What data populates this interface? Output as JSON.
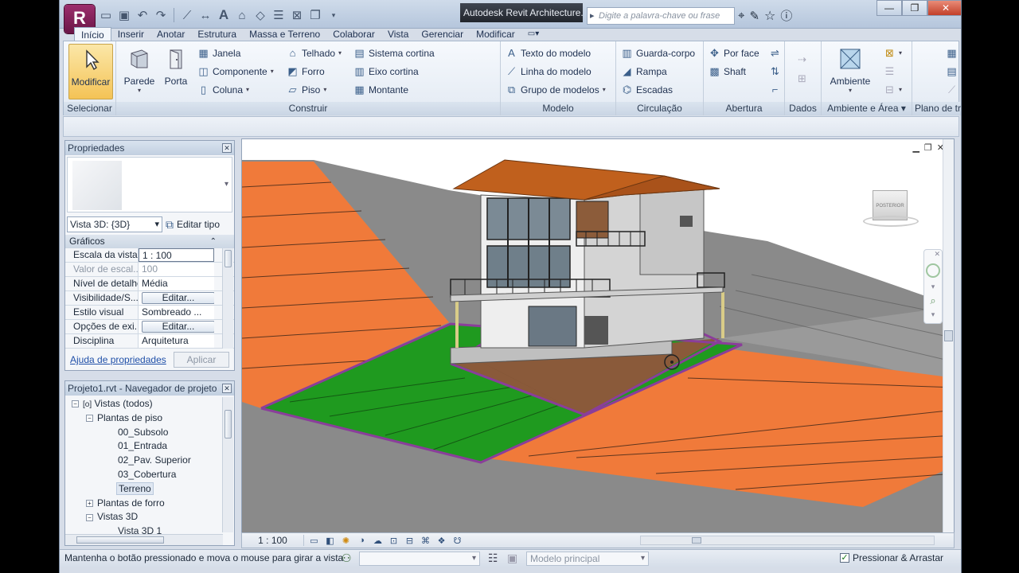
{
  "titlebar": {
    "app_title": "Autodesk Revit Architecture...",
    "search_placeholder": "Digite a palavra-chave ou frase",
    "app_button": "R"
  },
  "tabs": [
    "Início",
    "Inserir",
    "Anotar",
    "Estrutura",
    "Massa e Terreno",
    "Colaborar",
    "Vista",
    "Gerenciar",
    "Modificar"
  ],
  "ribbon": {
    "selecionar": {
      "label": "Selecionar",
      "modificar": "Modificar"
    },
    "construir": {
      "label": "Construir",
      "parede": "Parede",
      "porta": "Porta",
      "janela": "Janela",
      "componente": "Componente",
      "coluna": "Coluna",
      "telhado": "Telhado",
      "forro": "Forro",
      "piso": "Piso",
      "sistema_cortina": "Sistema cortina",
      "eixo_cortina": "Eixo cortina",
      "montante": "Montante"
    },
    "modelo": {
      "label": "Modelo",
      "texto": "Texto do modelo",
      "linha": "Linha do modelo",
      "grupo": "Grupo de modelos"
    },
    "circulacao": {
      "label": "Circulação",
      "guarda_corpo": "Guarda-corpo",
      "rampa": "Rampa",
      "escadas": "Escadas"
    },
    "abertura": {
      "label": "Abertura",
      "por_face": "Por face",
      "shaft": "Shaft"
    },
    "dados": {
      "label": "Dados"
    },
    "ambiente": {
      "label": "Ambiente e Área",
      "ambiente": "Ambiente"
    },
    "plano": {
      "label": "Plano de trabalho"
    }
  },
  "properties": {
    "title": "Propriedades",
    "view_type": "Vista 3D: {3D}",
    "edit_type": "Editar tipo",
    "category": "Gráficos",
    "rows": [
      {
        "key": "Escala da vista",
        "value": "1 : 100"
      },
      {
        "key": "Valor de escal...",
        "value": "100"
      },
      {
        "key": "Nível de detalhe",
        "value": "Média"
      },
      {
        "key": "Visibilidade/S...",
        "value": "Editar..."
      },
      {
        "key": "Estilo visual",
        "value": "Sombreado ..."
      },
      {
        "key": "Opções de exi...",
        "value": "Editar..."
      },
      {
        "key": "Disciplina",
        "value": "Arquitetura"
      }
    ],
    "help_link": "Ajuda de propriedades",
    "apply": "Aplicar"
  },
  "browser": {
    "title": "Projeto1.rvt - Navegador de projeto",
    "items": [
      "Vistas (todos)",
      "Plantas de piso",
      "00_Subsolo",
      "01_Entrada",
      "02_Pav. Superior",
      "03_Cobertura",
      "Terreno",
      "Plantas de forro",
      "Vistas 3D",
      "Vista 3D 1"
    ]
  },
  "viewbar": {
    "scale": "1 : 100"
  },
  "viewcube": {
    "face": "POSTERIOR"
  },
  "status": {
    "message": "Mantenha o botão pressionado e mova o mouse para girar a vista",
    "model": "Modelo principal",
    "drag": "Pressionar & Arrastar"
  },
  "colors": {
    "terrain_orange": "#f07a3a",
    "terrain_grass": "#1f9a1f",
    "terrain_gray": "#7a7a7a",
    "roof": "#c0601d",
    "property_line": "#8a3e9a"
  }
}
